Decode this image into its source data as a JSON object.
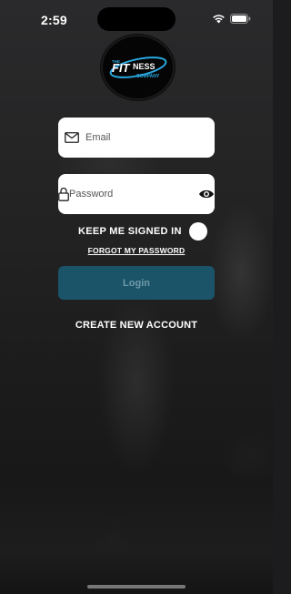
{
  "status_bar": {
    "time": "2:59"
  },
  "logo": {
    "line1": "THE",
    "line2": "FITNESS",
    "line3": "COMPANY"
  },
  "email_field": {
    "placeholder": "Email"
  },
  "password_field": {
    "placeholder": "Password"
  },
  "keep_signed_in": {
    "label": "KEEP ME SIGNED IN"
  },
  "forgot_password": {
    "label": "FORGOT MY PASSWORD"
  },
  "login_button": {
    "label": "Login"
  },
  "create_account": {
    "label": "CREATE NEW ACCOUNT"
  },
  "colors": {
    "accent": "#1b5468",
    "accent_text": "#6f9aa9",
    "logo_blue": "#29a8e0"
  }
}
